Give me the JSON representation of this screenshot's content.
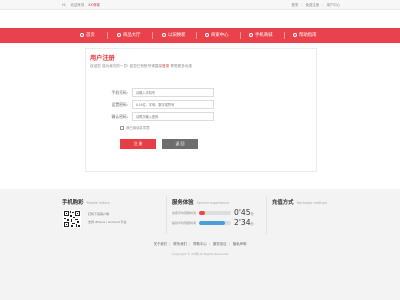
{
  "topbar": {
    "greeting": "Hi,",
    "welcome": "欢迎来到",
    "site_link": "XX商城",
    "login": "登录",
    "register": "免费注册",
    "my_account": "用户中心",
    "sep": "|"
  },
  "nav": {
    "items": [
      {
        "label": "首页",
        "icon": "home-icon"
      },
      {
        "label": "商品大厅",
        "icon": "shop-icon"
      },
      {
        "label": "以旧换新",
        "icon": "swap-icon"
      },
      {
        "label": "商家中心",
        "icon": "store-icon"
      },
      {
        "label": "手机商城",
        "icon": "phone-icon"
      },
      {
        "label": "帮助指南",
        "icon": "help-icon"
      }
    ]
  },
  "register": {
    "title": "用户注册",
    "hint_prefix": "欢迎您 成为我们的一员! 若您已有账号请直接",
    "hint_link": "登录",
    "hint_suffix": " 享受更多优惠",
    "fields": [
      {
        "label": "手机号码:",
        "value": "",
        "placeholder": "请输入手机号"
      },
      {
        "label": "设置密码:",
        "value": "",
        "placeholder": "6-16位，字母、数字或符号"
      },
      {
        "label": "确认密码:",
        "value": "",
        "placeholder": "请再次输入密码"
      }
    ],
    "agree_text": "我已阅读并同意",
    "submit_label": "注 册",
    "cancel_label": "返 回"
  },
  "footer": {
    "mobile": {
      "title": "手机购彩",
      "subtitle": "Mobile lottery",
      "line1": "扫码下载客户端",
      "line2": "支持 iPhone / Android 平台"
    },
    "service": {
      "title": "服务体验",
      "subtitle": "Service experience",
      "rows": [
        {
          "label": "充值平均到账时间",
          "fraction": 0.18,
          "color": "#e84a4d",
          "time_main": "0'45",
          "time_unit": "秒"
        },
        {
          "label": "提款平均到账时间",
          "fraction": 0.82,
          "color": "#4a9fd8",
          "time_main": "2'34",
          "time_unit": "秒"
        }
      ]
    },
    "recharge": {
      "title": "充值方式",
      "subtitle": "Recharge method"
    },
    "links": [
      "关于我们",
      "联系我们",
      "帮助中心",
      "服务协议",
      "隐私声明"
    ],
    "copyright": "Copyright © XX网 All Rights Reserved"
  }
}
